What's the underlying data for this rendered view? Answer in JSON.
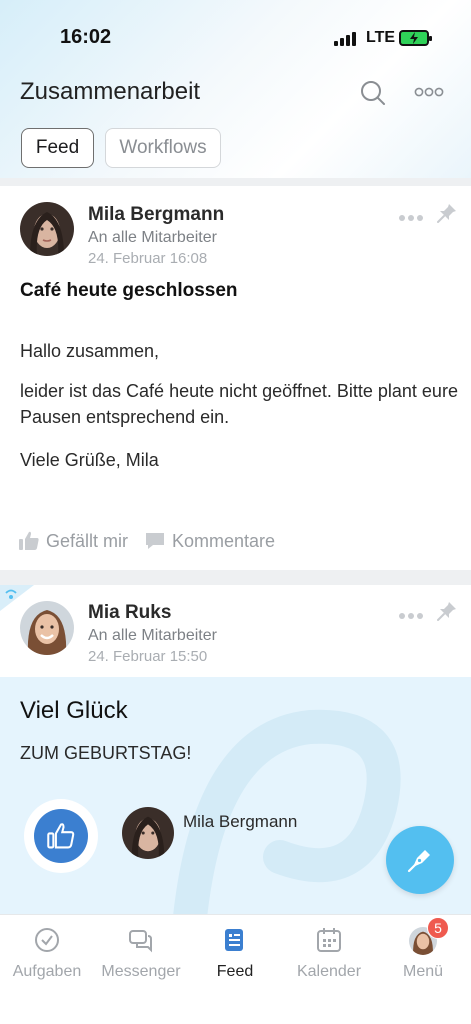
{
  "status": {
    "time": "16:02",
    "network": "LTE"
  },
  "header": {
    "title": "Zusammenarbeit",
    "search_icon": "search-icon",
    "more_icon": "more-icon"
  },
  "segments": [
    {
      "label": "Feed",
      "active": true
    },
    {
      "label": "Workflows",
      "active": false
    }
  ],
  "posts": [
    {
      "author": "Mila Bergmann",
      "audience": "An alle Mitarbeiter",
      "date": "24. Februar 16:08",
      "title": "Café heute geschlossen",
      "body": [
        "Hallo zusammen,",
        "leider ist das Café heute nicht geöffnet. Bitte plant eure Pausen entsprechend ein.",
        "Viele Grüße, Mila"
      ],
      "actions": {
        "like": "Gefällt mir",
        "comments": "Kommentare"
      }
    },
    {
      "author": "Mia Ruks",
      "audience": "An alle Mitarbeiter",
      "date": "24. Februar 15:50",
      "greeting": {
        "title": "Viel Glück",
        "subtitle": "ZUM GEBURTSTAG!",
        "liked_by": "Mila Bergmann",
        "background": "#e5f4fd"
      }
    }
  ],
  "tabbar": {
    "items": [
      {
        "label": "Aufgaben",
        "icon": "check-circle-icon",
        "active": false
      },
      {
        "label": "Messenger",
        "icon": "chat-icon",
        "active": false
      },
      {
        "label": "Feed",
        "icon": "feed-icon",
        "active": true
      },
      {
        "label": "Kalender",
        "icon": "calendar-icon",
        "active": false
      },
      {
        "label": "Menü",
        "icon": "avatar-icon",
        "active": false,
        "badge": "5"
      }
    ]
  },
  "colors": {
    "accent": "#3b7fd0",
    "fab": "#53bff0",
    "badge": "#ef5a4f"
  }
}
